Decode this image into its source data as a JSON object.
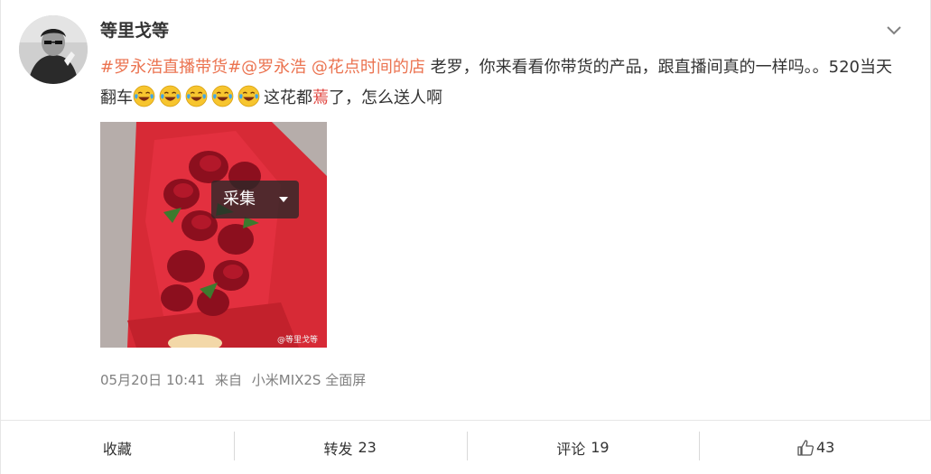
{
  "user": {
    "name": "等里戈等"
  },
  "post": {
    "hashtag1": "#罗永浩直播带货#",
    "mention1": "@罗永浩",
    "mention2_prefix": " @",
    "store_name": "花点时间的店",
    "text1": " 老罗，你来看看你带货的产品，跟直播间真的一样吗。。520当天翻车",
    "text2": "这花都",
    "red_char": "蔫",
    "text3": "了，怎么送人啊",
    "emoji_name": "laugh-cry-emoji",
    "emoji_count": 5
  },
  "photo": {
    "watermark": "@等里戈等",
    "collect_label": "采集"
  },
  "meta": {
    "time": "05月20日 10:41",
    "source_prefix": "来自",
    "source": "小米MIX2S 全面屏"
  },
  "actions": {
    "favorite": "收藏",
    "repost_label": "转发",
    "repost_count": "23",
    "comment_label": "评论",
    "comment_count": "19",
    "like_count": "43"
  },
  "colors": {
    "link": "#eb7350",
    "red_text": "#e0433d",
    "meta_text": "#808080"
  }
}
